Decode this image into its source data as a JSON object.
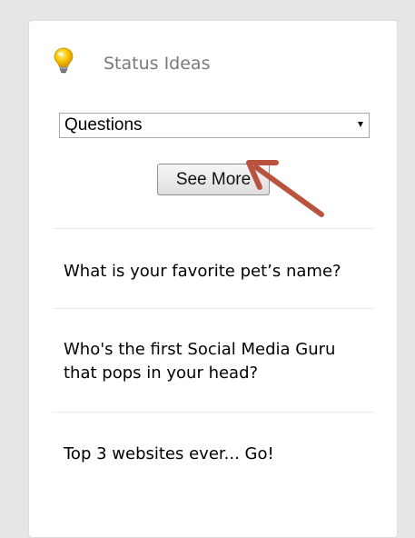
{
  "widget": {
    "title": "Status Ideas",
    "icon": "lightbulb-icon",
    "select": {
      "value": "Questions"
    },
    "see_more_label": "See More",
    "ideas": [
      "What is your favorite pet’s name?",
      "Who's the first Social Media Guru that pops in your head?",
      "Top 3 websites ever... Go!"
    ]
  },
  "colors": {
    "page_bg": "#e6e6e6",
    "card_bg": "#ffffff",
    "title_text": "#7a7a7a",
    "arrow": "#b9533d",
    "bulb": "#f5c400"
  }
}
